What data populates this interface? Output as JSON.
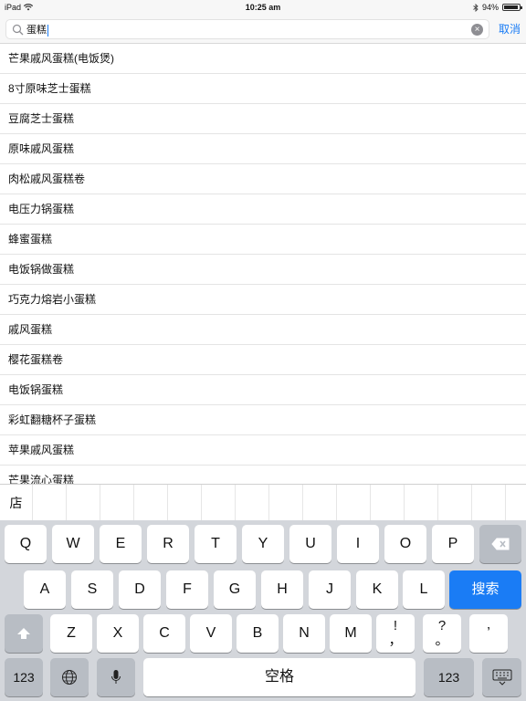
{
  "status": {
    "device": "iPad",
    "time": "10:25 am",
    "battery": "94%",
    "battery_level": 0.94
  },
  "search": {
    "value": "蛋糕",
    "cancel_label": "取消"
  },
  "results": [
    "芒果戚风蛋糕(电饭煲)",
    "8寸原味芝士蛋糕",
    "豆腐芝士蛋糕",
    "原味戚风蛋糕",
    "肉松戚风蛋糕卷",
    "电压力锅蛋糕",
    "蜂蜜蛋糕",
    "电饭锅做蛋糕",
    "巧克力熔岩小蛋糕",
    "戚风蛋糕",
    "樱花蛋糕卷",
    "电饭锅蛋糕",
    "彩虹翻糖杯子蛋糕",
    "苹果戚风蛋糕",
    "芒果流心蛋糕"
  ],
  "candidates": {
    "first": "店"
  },
  "keyboard": {
    "row1": [
      "Q",
      "W",
      "E",
      "R",
      "T",
      "Y",
      "U",
      "I",
      "O",
      "P"
    ],
    "row2": [
      "A",
      "S",
      "D",
      "F",
      "G",
      "H",
      "J",
      "K",
      "L"
    ],
    "row3": [
      "Z",
      "X",
      "C",
      "V",
      "B",
      "N",
      "M"
    ],
    "search_label": "搜索",
    "space_label": "空格",
    "numbers_label": "123",
    "punct_1": "!",
    "punct_1b": "，",
    "punct_2": "?",
    "punct_2b": "。",
    "punct_3": "’"
  },
  "colors": {
    "accent": "#1a7cf5",
    "keyboard_bg": "#d3d6db"
  }
}
